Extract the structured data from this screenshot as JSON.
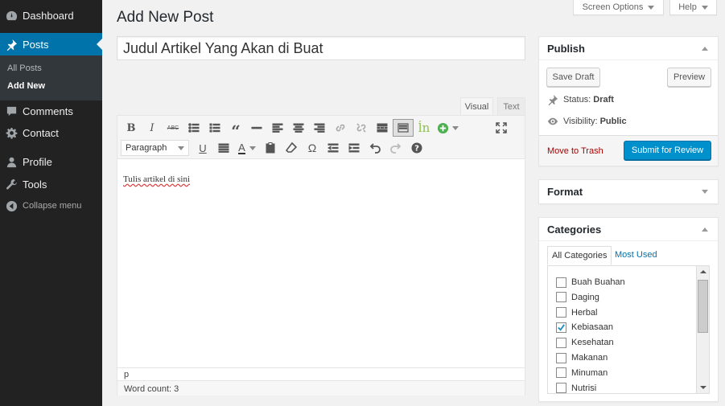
{
  "sidebar": {
    "items": [
      {
        "label": "Dashboard",
        "icon": "dashboard-icon"
      },
      {
        "label": "Posts",
        "icon": "pin-icon"
      },
      {
        "label": "Comments",
        "icon": "comment-icon"
      },
      {
        "label": "Contact",
        "icon": "gear-icon"
      },
      {
        "label": "Profile",
        "icon": "user-icon"
      },
      {
        "label": "Tools",
        "icon": "wrench-icon"
      },
      {
        "label": "Collapse menu",
        "icon": "collapse-icon"
      }
    ],
    "submenu": [
      "All Posts",
      "Add New"
    ]
  },
  "top": {
    "screen_options": "Screen Options",
    "help": "Help"
  },
  "page": {
    "title": "Add New Post"
  },
  "post": {
    "title": "Judul Artikel Yang Akan di Buat"
  },
  "editor": {
    "tab_visual": "Visual",
    "tab_text": "Text",
    "format": "Paragraph",
    "content": "Tulis artikel di sini",
    "path": "p",
    "word_count": "Word count: 3"
  },
  "publish": {
    "title": "Publish",
    "save_draft": "Save Draft",
    "preview": "Preview",
    "status_label": "Status:",
    "status_value": "Draft",
    "visibility_label": "Visibility:",
    "visibility_value": "Public",
    "trash": "Move to Trash",
    "submit": "Submit for Review"
  },
  "format_box": {
    "title": "Format"
  },
  "categories": {
    "title": "Categories",
    "tab_all": "All Categories",
    "tab_used": "Most Used",
    "items": [
      {
        "label": "Buah Buahan",
        "checked": false
      },
      {
        "label": "Daging",
        "checked": false
      },
      {
        "label": "Herbal",
        "checked": false
      },
      {
        "label": "Kebiasaan",
        "checked": true
      },
      {
        "label": "Kesehatan",
        "checked": false
      },
      {
        "label": "Makanan",
        "checked": false
      },
      {
        "label": "Minuman",
        "checked": false
      },
      {
        "label": "Nutrisi",
        "checked": false
      }
    ]
  },
  "colors": {
    "accent": "#0073aa",
    "primary_button": "#0091cd",
    "trash": "#a00000",
    "sidebar": "#222222"
  }
}
